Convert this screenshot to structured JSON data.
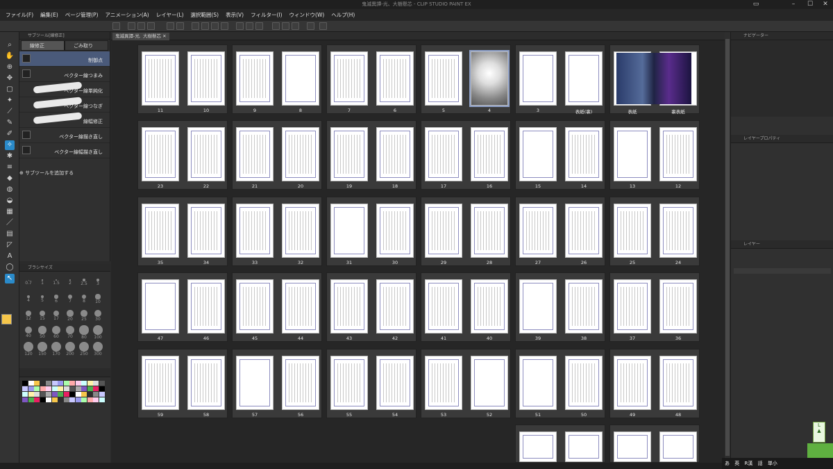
{
  "window": {
    "title": "鬼滅異譚-光、大樹懸芯 - CLIP STUDIO PAINT EX"
  },
  "menu": [
    "ファイル(F)",
    "編集(E)",
    "ページ管理(P)",
    "アニメーション(A)",
    "レイヤー(L)",
    "選択範囲(S)",
    "表示(V)",
    "フィルター(I)",
    "ウィンドウ(W)",
    "ヘルプ(H)"
  ],
  "doc_tabs": [
    "鬼滅異譚-光、",
    "大樹懸芯"
  ],
  "subtool": {
    "panel_title": "サブツール[線修正]",
    "tabs": [
      "線修正",
      "ごみ取り"
    ],
    "items": [
      "制御点",
      "ベクター線つまみ",
      "ベクター線単純化",
      "ベクター線つなぎ",
      "線幅修正",
      "ベクター線描き直し",
      "ベクター線幅描き直し"
    ],
    "add_label": "サブツールを追加する"
  },
  "brush_size": {
    "panel_title": "ブラシサイズ",
    "sizes": [
      "0.7",
      "1",
      "1.5",
      "2",
      "2.5",
      "3",
      "4",
      "5",
      "6",
      "7",
      "8",
      "10",
      "12",
      "15",
      "17",
      "20",
      "25",
      "30",
      "40",
      "50",
      "60",
      "70",
      "80",
      "100",
      "120",
      "150",
      "170",
      "200",
      "250",
      "300"
    ]
  },
  "pages": {
    "spreads": [
      [
        "11",
        "10"
      ],
      [
        "9",
        "8"
      ],
      [
        "7",
        "6"
      ],
      [
        "5",
        "4"
      ],
      [
        "3",
        "表紙(裏)"
      ],
      [
        "表紙",
        "裏表紙"
      ],
      [
        "23",
        "22"
      ],
      [
        "21",
        "20"
      ],
      [
        "19",
        "18"
      ],
      [
        "17",
        "16"
      ],
      [
        "15",
        "14"
      ],
      [
        "13",
        "12"
      ],
      [
        "35",
        "34"
      ],
      [
        "33",
        "32"
      ],
      [
        "31",
        "30"
      ],
      [
        "29",
        "28"
      ],
      [
        "27",
        "26"
      ],
      [
        "25",
        "24"
      ],
      [
        "47",
        "46"
      ],
      [
        "45",
        "44"
      ],
      [
        "43",
        "42"
      ],
      [
        "41",
        "40"
      ],
      [
        "39",
        "38"
      ],
      [
        "37",
        "36"
      ],
      [
        "59",
        "58"
      ],
      [
        "57",
        "56"
      ],
      [
        "55",
        "54"
      ],
      [
        "53",
        "52"
      ],
      [
        "51",
        "50"
      ],
      [
        "49",
        "48"
      ]
    ],
    "selected_page": "4"
  },
  "right_panel": {
    "navigator_title": "ナビゲーター",
    "layer_property_title": "レイヤープロパティ",
    "layer_title": "レイヤー"
  },
  "ime": {
    "items": [
      "あ",
      "英",
      "R漢",
      "話",
      "単小"
    ]
  },
  "colors": {
    "selection": "#2a8ac9",
    "main_color": "#f6c64a",
    "sub_color": "#ffffff"
  }
}
